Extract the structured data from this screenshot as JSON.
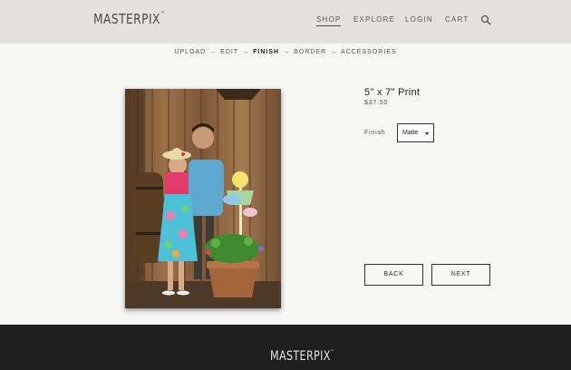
{
  "brand": {
    "logo": "MASTERPIX",
    "tm": "™"
  },
  "nav": {
    "shop": "SHOP",
    "explore": "EXPLORE",
    "login": "LOGIN",
    "cart": "CART"
  },
  "steps": {
    "upload": "UPLOAD",
    "edit": "EDIT",
    "finish": "FINISH",
    "border": "BORDER",
    "accessories": "ACCESSORIES",
    "arrow": "→"
  },
  "product": {
    "title": "5\" x 7\" Print",
    "price": "$37.50"
  },
  "finish": {
    "label": "Finish",
    "selected": "Matte"
  },
  "buttons": {
    "back": "BACK",
    "next": "NEXT"
  },
  "footer": {
    "logo": "MASTERPIX",
    "tm": "™"
  },
  "icons": {
    "search": "search-icon",
    "dropdown": "caret-down-icon"
  },
  "colors": {
    "header_bg": "#e4e2dc",
    "page_bg": "#f6f6f5",
    "footer_bg": "#1e1e1e"
  }
}
